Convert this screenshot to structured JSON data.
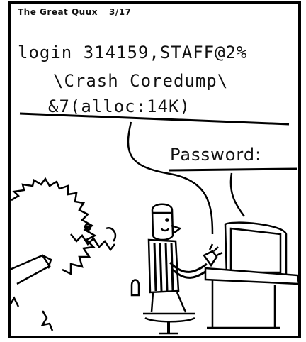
{
  "comic": {
    "author": "The Great Quux",
    "date": "3/17"
  },
  "screen": {
    "line1": "login 314159,STAFF@2%",
    "line2": "\\Crash Coredump\\",
    "line3": "&7(alloc:14K)"
  },
  "prompt": {
    "text": "Password:"
  }
}
